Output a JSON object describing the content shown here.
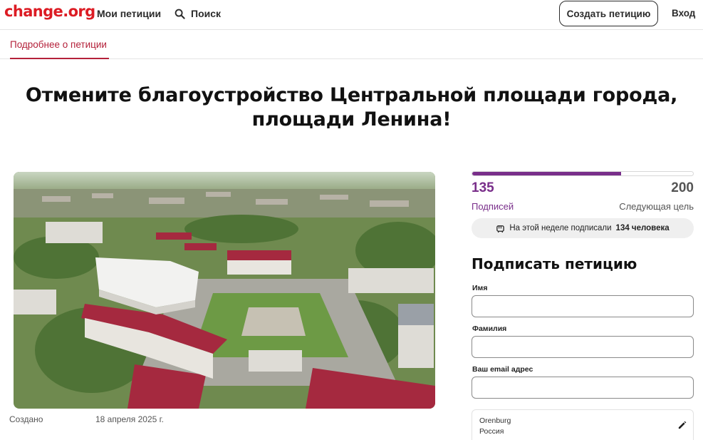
{
  "nav": {
    "logo": "change.org",
    "my_petitions": "Мои петиции",
    "search": "Поиск",
    "create_petition": "Создать петицию",
    "login": "Вход"
  },
  "tabs": {
    "details": "Подробнее о петиции"
  },
  "petition": {
    "title": "Отмените благоустройство Центральной площади города, площади Ленина!",
    "created_label": "Создано",
    "created_date": "18 апреля 2025 г."
  },
  "progress": {
    "signatures": "135",
    "signatures_label": "Подписей",
    "goal": "200",
    "goal_label": "Следующая цель",
    "fraction": 0.675,
    "weekly_prefix": "На этой неделе подписали",
    "weekly_count": "134 человека"
  },
  "sign_form": {
    "heading": "Подписать петицию",
    "first_name_label": "Имя",
    "first_name_value": "",
    "last_name_label": "Фамилия",
    "last_name_value": "",
    "email_label": "Ваш email адрес",
    "email_value": "",
    "location_city": "Orenburg",
    "location_country": "Россия"
  },
  "colors": {
    "brand_red": "#dc1c24",
    "accent_purple": "#792e8a",
    "tab_red": "#b4213a"
  },
  "icons": {
    "search": "search-icon",
    "weekly": "raised-fist-icon",
    "edit": "pencil-icon"
  }
}
